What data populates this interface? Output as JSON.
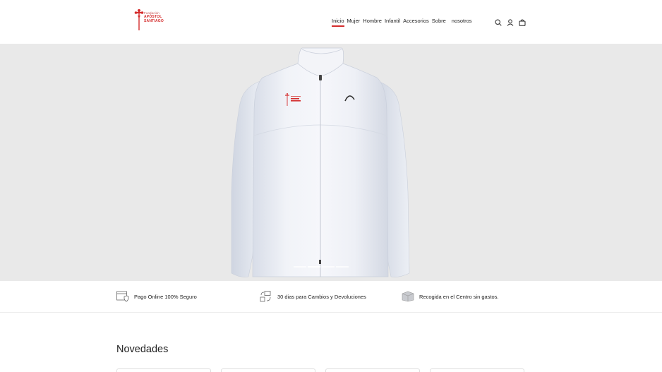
{
  "header": {
    "logo": {
      "small_text": "Fundación",
      "line1": "APÓSTOL",
      "line2": "SANTIAGO",
      "brand_color": "#d42c2c"
    },
    "nav": [
      {
        "label": "Inicio",
        "active": true
      },
      {
        "label": "Mujer"
      },
      {
        "label": "Hombre"
      },
      {
        "label": "Infantil"
      },
      {
        "label": "Accesorios"
      },
      {
        "label": "Sobre"
      },
      {
        "label": "nosotros"
      }
    ],
    "icons": [
      "search-icon",
      "user-icon",
      "bag-icon"
    ]
  },
  "hero": {
    "background": "#e9e9e9",
    "image": "white-sports-jacket",
    "jacket_logo": {
      "small_text": "Fundación",
      "line1": "APÓSTOL",
      "line2": "SANTIAGO"
    },
    "slides": 4,
    "active_slide": 2
  },
  "features": [
    {
      "icon": "secure-payment-icon",
      "label": "Pago Online 100% Seguro"
    },
    {
      "icon": "returns-icon",
      "label": "30 dias para Cambios y Devoluciones"
    },
    {
      "icon": "pickup-box-icon",
      "label": "Recogida en el Centro sin gastos."
    }
  ],
  "novedades": {
    "title": "Novedades"
  },
  "colors": {
    "accent": "#d42c2c",
    "text": "#222222"
  }
}
